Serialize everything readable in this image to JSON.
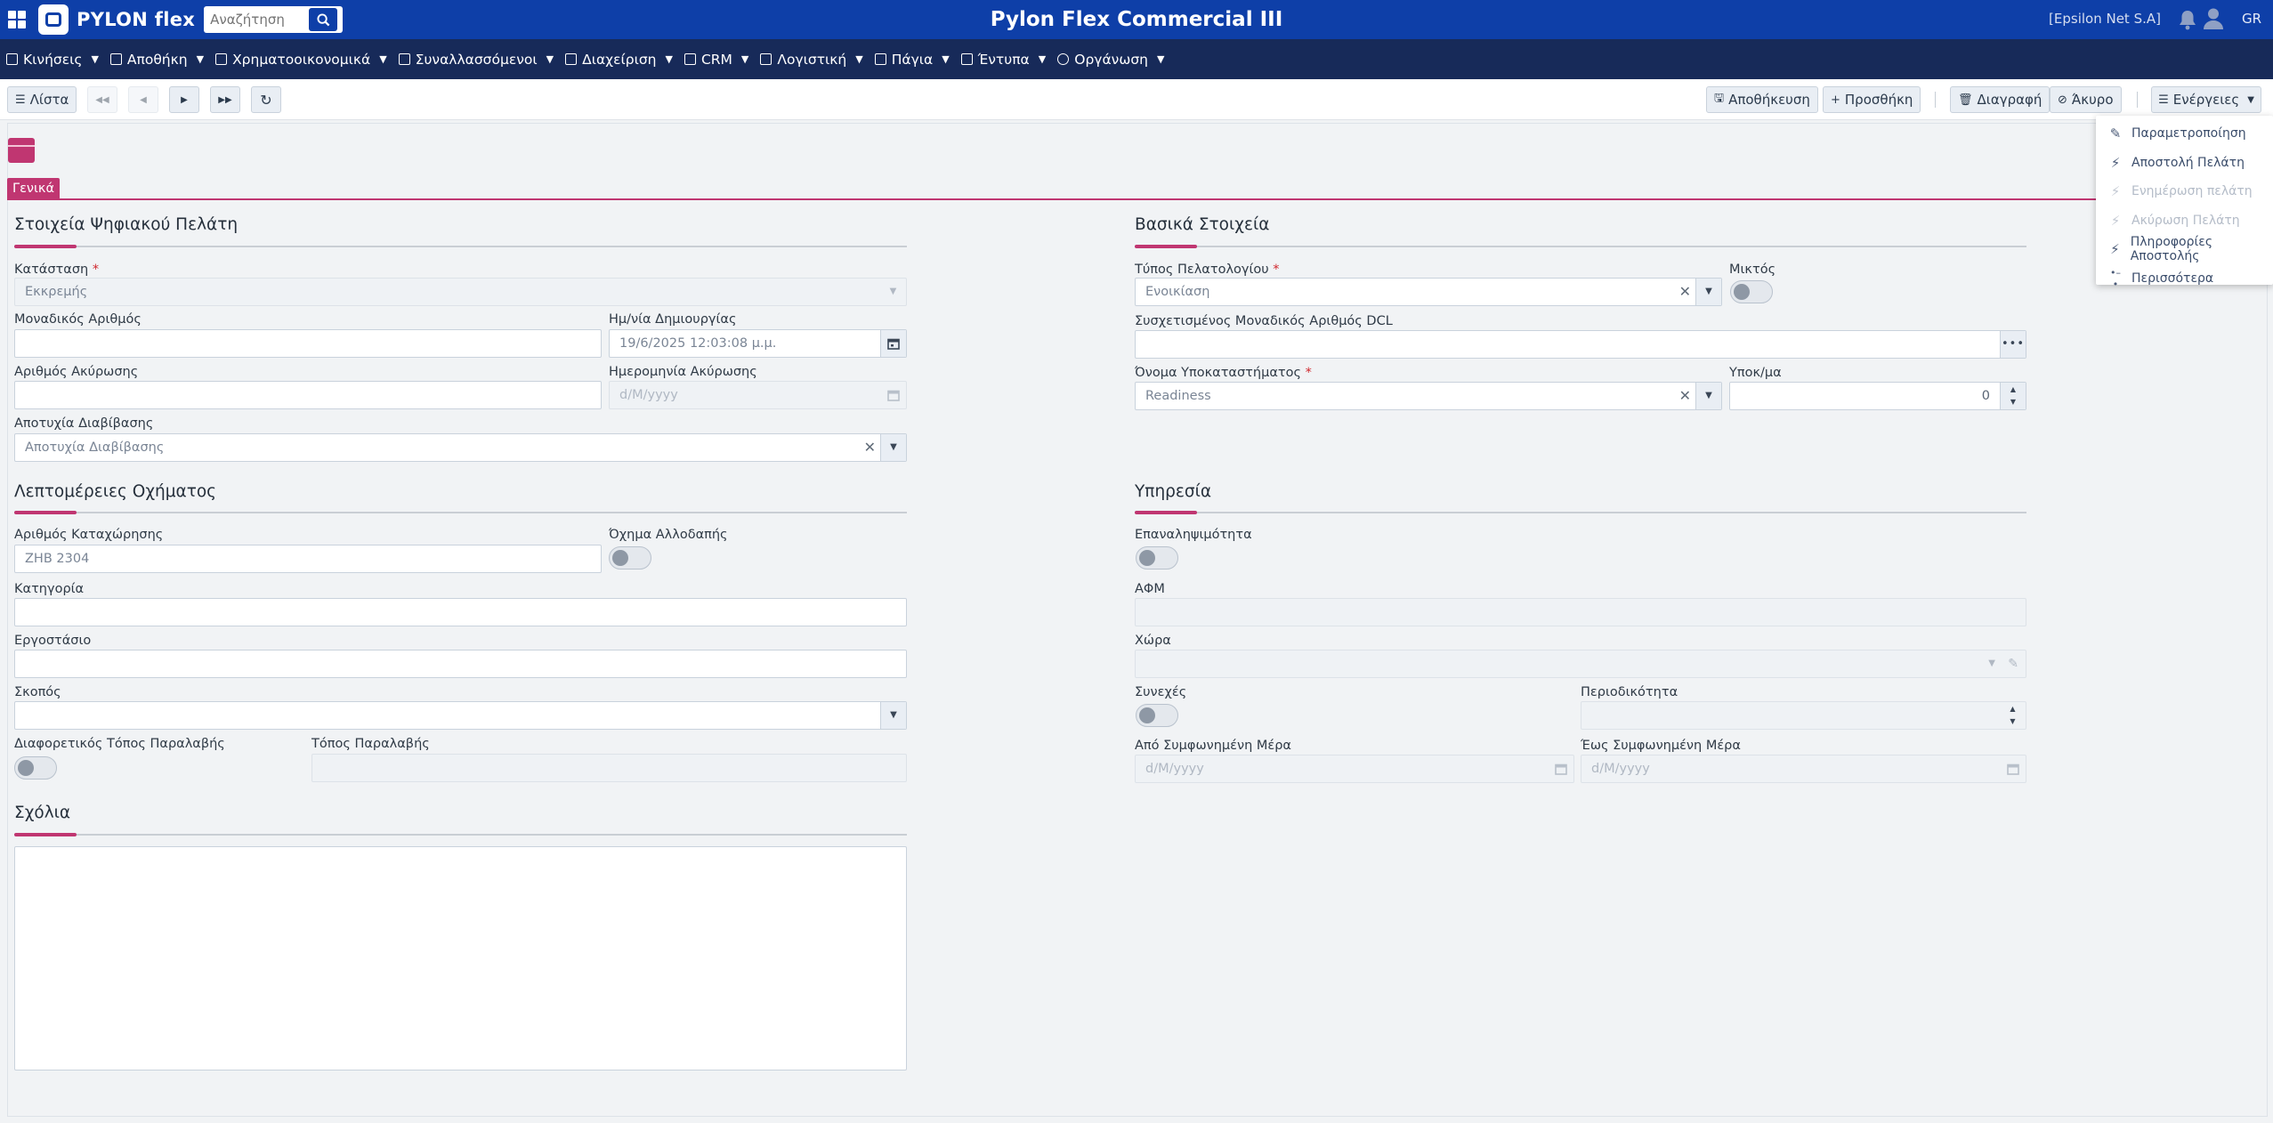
{
  "header": {
    "brand_name": "PYLON flex",
    "search_placeholder": "Αναζήτηση",
    "app_title": "Pylon Flex Commercial III",
    "company": "[Epsilon Net S.A]",
    "language": "GR"
  },
  "menu": [
    {
      "label": "Κινήσεις"
    },
    {
      "label": "Αποθήκη"
    },
    {
      "label": "Χρηματοοικονομικά"
    },
    {
      "label": "Συναλλασσόμενοι"
    },
    {
      "label": "Διαχείριση"
    },
    {
      "label": "CRM"
    },
    {
      "label": "Λογιστική"
    },
    {
      "label": "Πάγια"
    },
    {
      "label": "Έντυπα"
    },
    {
      "label": "Οργάνωση"
    }
  ],
  "toolbar": {
    "list": "Λίστα",
    "save": "Αποθήκευση",
    "add": "Προσθήκη",
    "delete": "Διαγραφή",
    "cancel": "Άκυρο",
    "actions": "Ενέργειες"
  },
  "actions_menu": [
    {
      "label": "Παραμετροποίηση",
      "icon": "edit-icon",
      "disabled": false
    },
    {
      "label": "Αποστολή Πελάτη",
      "icon": "bolt-icon",
      "disabled": false
    },
    {
      "label": "Ενημέρωση πελάτη",
      "icon": "bolt-icon",
      "disabled": true
    },
    {
      "label": "Ακύρωση Πελάτη",
      "icon": "bolt-icon",
      "disabled": true
    },
    {
      "label": "Πληροφορίες Αποστολής",
      "icon": "bolt-icon",
      "disabled": false
    },
    {
      "label": "Περισσότερα",
      "icon": "dots-icon",
      "disabled": false
    }
  ],
  "tab": "Γενικά",
  "sections": {
    "digital_customer": {
      "title": "Στοιχεία Ψηφιακού Πελάτη",
      "status_label": "Κατάσταση",
      "status_value": "Εκκρεμής",
      "unique_number_label": "Μοναδικός Αριθμός",
      "created_label": "Ημ/νία Δημιουργίας",
      "created_value": "19/6/2025 12:03:08 μ.μ.",
      "cancel_number_label": "Αριθμός Ακύρωσης",
      "cancel_date_label": "Ημερομηνία Ακύρωσης",
      "cancel_date_placeholder": "d/M/yyyy",
      "failure_label": "Αποτυχία Διαβίβασης",
      "failure_value": "Αποτυχία Διαβίβασης"
    },
    "basic": {
      "title": "Βασικά Στοιχεία",
      "customer_type_label": "Τύπος Πελατολογίου",
      "customer_type_value": "Ενοικίαση",
      "mixed_label": "Μικτός",
      "dcl_label": "Συσχετισμένος Μοναδικός Αριθμός DCL",
      "branch_name_label": "Όνομα Υποκαταστήματος",
      "branch_name_value": "Readiness",
      "branch_label": "Υποκ/μα",
      "branch_value": "0"
    },
    "vehicle": {
      "title": "Λεπτομέρειες Οχήματος",
      "registration_label": "Αριθμός Καταχώρησης",
      "registration_value": "ZHB 2304",
      "foreign_label": "Όχημα Αλλοδαπής",
      "category_label": "Κατηγορία",
      "factory_label": "Εργοστάσιο",
      "purpose_label": "Σκοπός",
      "diff_pickup_label": "Διαφορετικός Τόπος Παραλαβής",
      "pickup_label": "Τόπος Παραλαβής"
    },
    "service": {
      "title": "Υπηρεσία",
      "repeatability_label": "Επαναληψιμότητα",
      "vat_label": "ΑΦΜ",
      "country_label": "Χώρα",
      "continuous_label": "Συνεχές",
      "periodicity_label": "Περιοδικότητα",
      "from_day_label": "Από Συμφωνημένη Μέρα",
      "from_day_placeholder": "d/M/yyyy",
      "to_day_label": "Έως Συμφωνημένη Μέρα",
      "to_day_placeholder": "d/M/yyyy"
    },
    "comments": {
      "title": "Σχόλια"
    }
  },
  "colors": {
    "topbar": "#0e3fa8",
    "menubar": "#172a59",
    "accent": "#c03671"
  }
}
